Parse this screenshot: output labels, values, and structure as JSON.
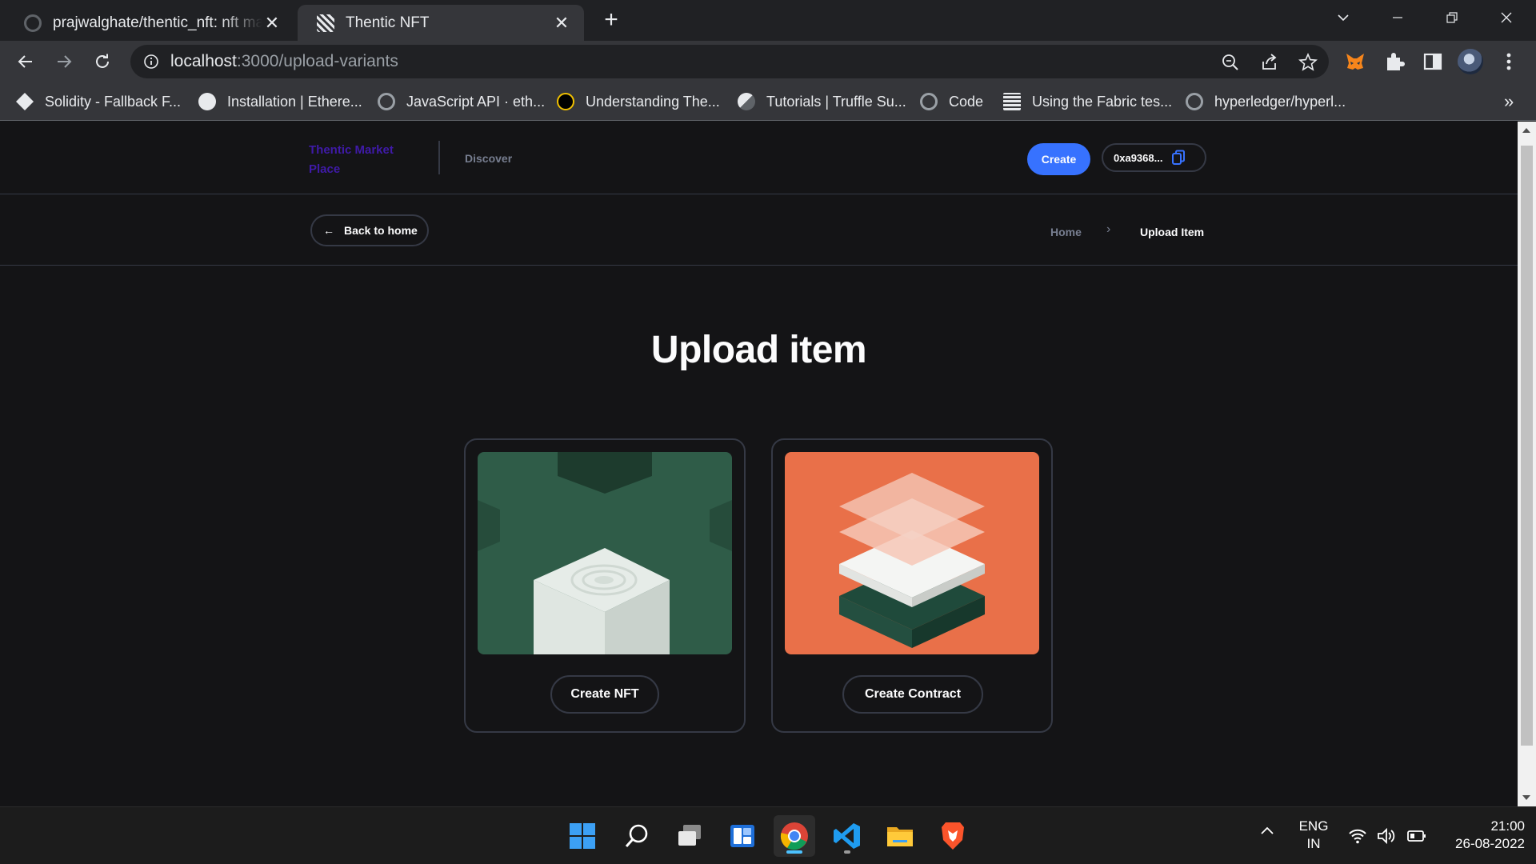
{
  "browser": {
    "tabs": [
      {
        "title": "prajwalghate/thentic_nft: nft mar",
        "active": false
      },
      {
        "title": "Thentic NFT",
        "active": true
      }
    ],
    "new_tab_glyph": "+",
    "close_glyph": "✕",
    "url_host": "localhost",
    "url_path": ":3000/upload-variants",
    "bookmarks": [
      {
        "label": "Solidity - Fallback F...",
        "icon": "solidity-icon"
      },
      {
        "label": "Installation | Ethere...",
        "icon": "globe-icon"
      },
      {
        "label": "JavaScript API · eth...",
        "icon": "github-icon"
      },
      {
        "label": "Understanding The...",
        "icon": "site-icon"
      },
      {
        "label": "Tutorials | Truffle Su...",
        "icon": "truffle-icon"
      },
      {
        "label": "Code",
        "icon": "github-icon"
      },
      {
        "label": "Using the Fabric tes...",
        "icon": "doc-icon"
      },
      {
        "label": "hyperledger/hyperl...",
        "icon": "github-icon"
      }
    ],
    "bookmarks_overflow": "»"
  },
  "site": {
    "logo": "Thentic Market Place",
    "nav_discover": "Discover",
    "create_label": "Create",
    "wallet_address": "0xa9368..."
  },
  "breadcrumb": {
    "back_label": "Back to home",
    "back_arrow": "←",
    "home": "Home",
    "separator": "›",
    "current": "Upload Item"
  },
  "main": {
    "heading": "Upload item",
    "cards": [
      {
        "button": "Create NFT",
        "art": "white-cube-green-background"
      },
      {
        "button": "Create Contract",
        "art": "stacked-layers-orange-background"
      }
    ]
  },
  "colors": {
    "page_bg": "#141416",
    "accent_blue": "#3772ff",
    "logo_purple": "#3f1aa8",
    "border": "#353945",
    "muted_text": "#777e90",
    "card1_bg": "#2f5c48",
    "card2_bg": "#e97049"
  },
  "taskbar": {
    "apps": [
      "windows-start-icon",
      "search-icon",
      "task-view-icon",
      "widgets-icon",
      "chrome-icon",
      "vscode-icon",
      "file-explorer-icon",
      "brave-icon"
    ],
    "lang_1": "ENG",
    "lang_2": "IN",
    "time": "21:00",
    "date": "26-08-2022",
    "tray_chevron": "^"
  }
}
